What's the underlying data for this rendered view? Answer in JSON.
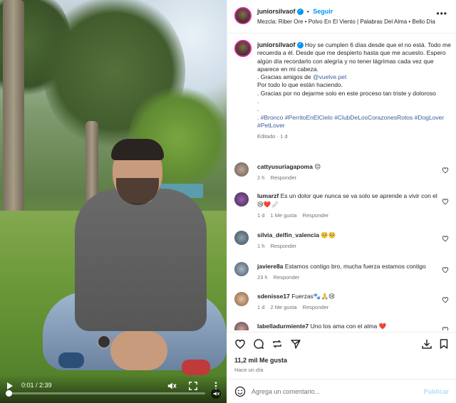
{
  "post": {
    "username": "juniorsilvaof",
    "follow_label": "Seguir",
    "audio": "Mezcla: Riber Ore • Polvo En El Viento | Palabras Del Alma • Bello Día",
    "more_label": "•••"
  },
  "caption": {
    "username": "juniorsilvaof",
    "lines": [
      "Hoy se cumplen 6 días desde que el no está. Todo me recuerda a él. Desde que me despierto hasta que me acuesto. Espero algún día recordarlo con alegría y no tener lágrimas cada vez que aparece en mi cabeza.",
      ". Gracias amigos de",
      "@vuelve.pet",
      "Por todo lo que están haciendo.",
      ". Gracias por no dejarme solo en este proceso tan triste y doloroso",
      ".",
      ".",
      ". #Bronco #PerritoEnElCielo #ClubDeLosCorazonesRotos #DogLover #PetLover"
    ],
    "meta": "Editado · 1 d"
  },
  "comments": [
    {
      "user": "cattyusuriagapoma",
      "text": "😔",
      "time": "2 h",
      "likes": "",
      "reply": "Responder"
    },
    {
      "user": "lumarzf",
      "text": "Es un dolor que nunca se va solo se aprende a vivir con el 😢❤️🩹",
      "time": "1 d",
      "likes": "1 Me gusta",
      "reply": "Responder"
    },
    {
      "user": "silvia_delfin_valencia",
      "text": "🥺🥺",
      "time": "1 h",
      "likes": "",
      "reply": "Responder"
    },
    {
      "user": "javiere8a",
      "text": "Estamos contigo bro, mucha fuerza estamos contigo",
      "time": "23 h",
      "likes": "",
      "reply": "Responder"
    },
    {
      "user": "sdenisse17",
      "text": "Fuerzas🐾🙏😢",
      "time": "1 d",
      "likes": "2 Me gusta",
      "reply": "Responder"
    },
    {
      "user": "labelladurmiente7",
      "text": "Uno los ama con el alma ❤️",
      "time": "",
      "likes": "",
      "reply": ""
    }
  ],
  "stats": {
    "likes": "11,2 mil Me gusta",
    "ago": "Hace un día"
  },
  "composer": {
    "placeholder": "Agrega un comentario...",
    "post_label": "Publicar"
  },
  "video": {
    "time": "0:01 / 2:39",
    "progress": 0.006
  }
}
